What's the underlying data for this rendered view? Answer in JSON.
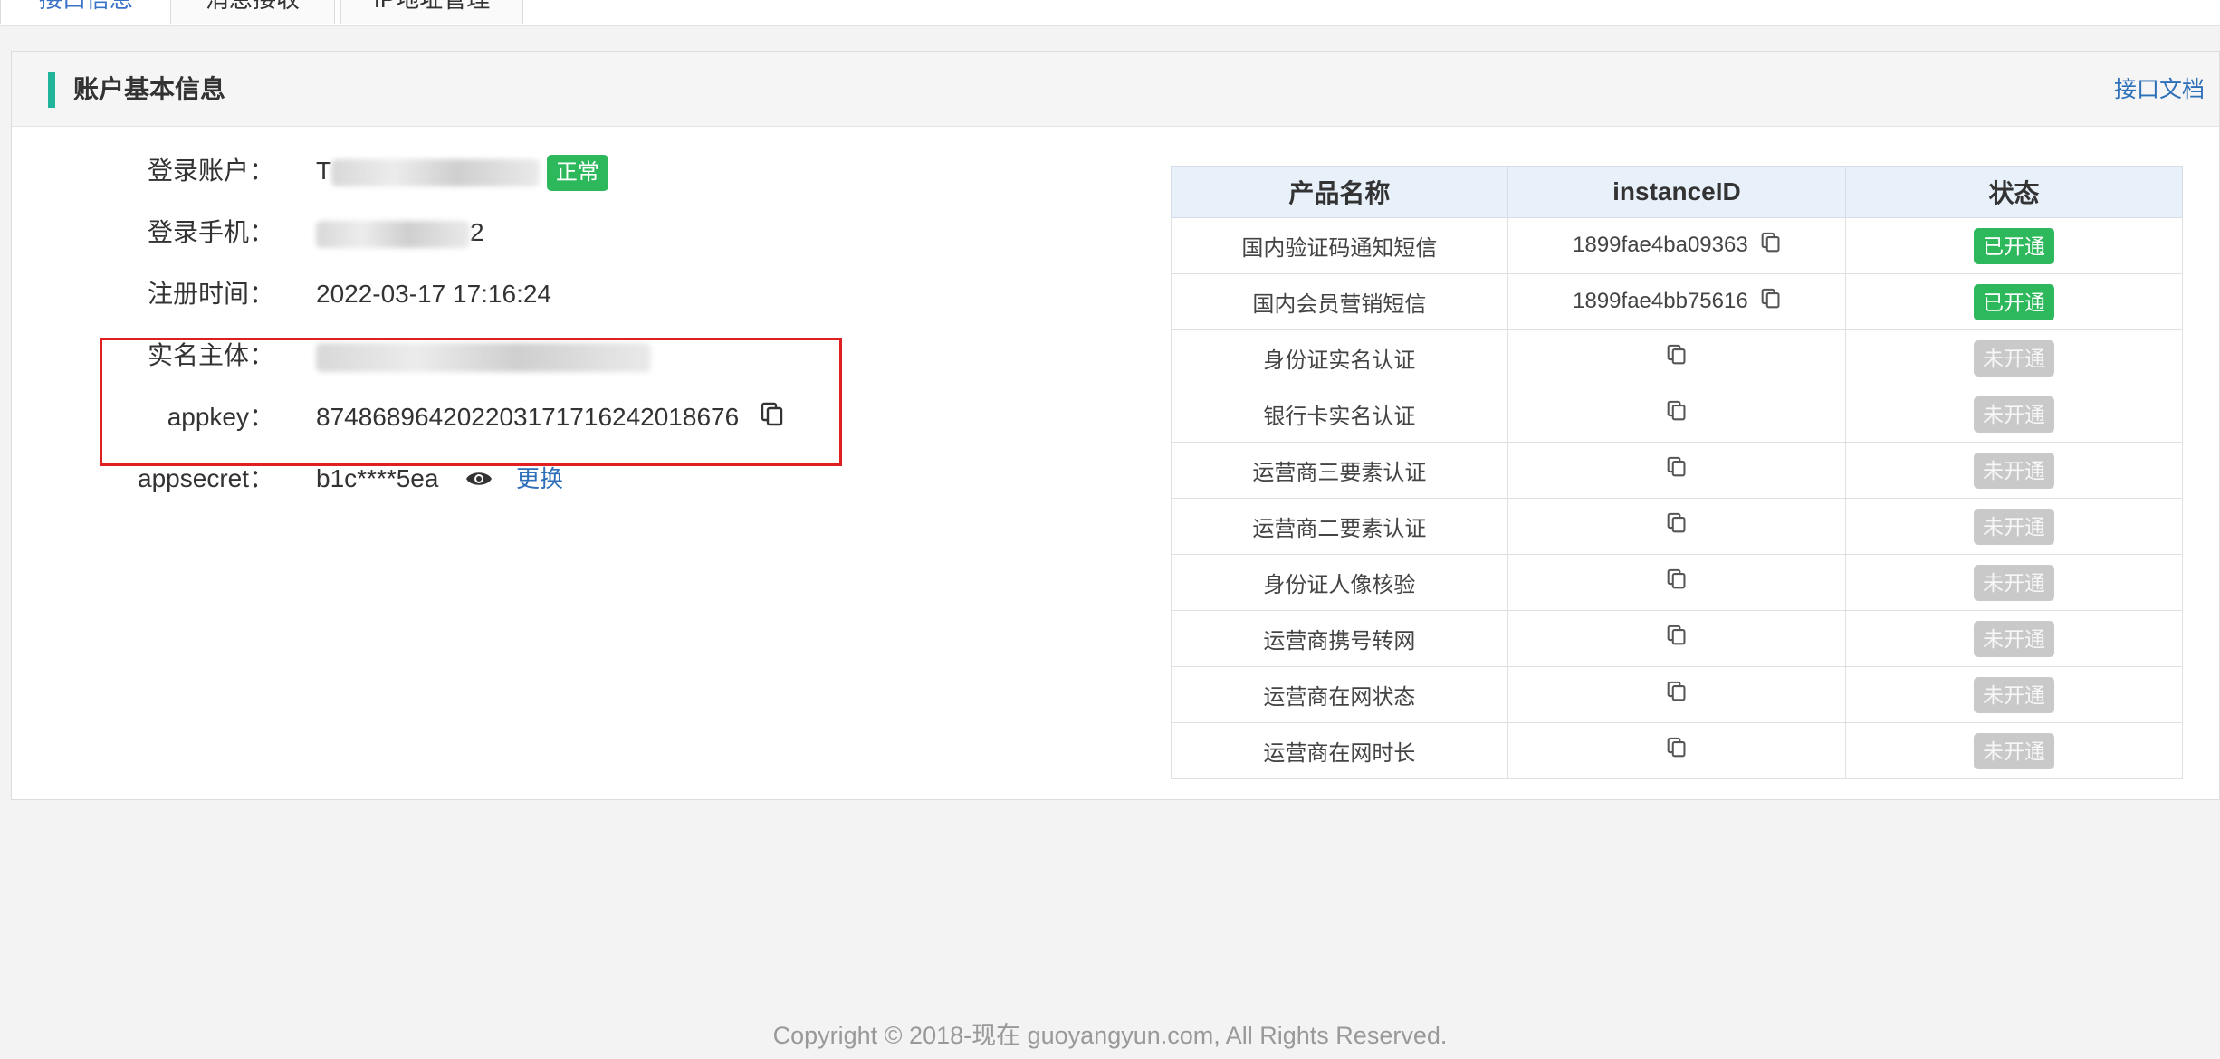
{
  "tabs": [
    {
      "label": "接口信息",
      "active": true
    },
    {
      "label": "消息接收",
      "active": false
    },
    {
      "label": "IP地址管理",
      "active": false
    }
  ],
  "panel": {
    "title": "账户基本信息",
    "doc_link": "接口文档"
  },
  "info": {
    "login_account_label": "登录账户：",
    "login_account_value_prefix": "T",
    "login_account_value_suffix": "",
    "status_badge": "正常",
    "login_phone_label": "登录手机：",
    "login_phone_suffix": "2",
    "register_time_label": "注册时间：",
    "register_time_value": "2022-03-17 17:16:24",
    "real_name_label": "实名主体：",
    "appkey_label": "appkey：",
    "appkey_value": "874868964202203171716242018676",
    "appsecret_label": "appsecret：",
    "appsecret_value": "b1c****5ea",
    "change_label": "更换"
  },
  "table": {
    "headers": [
      "产品名称",
      "instanceID",
      "状态"
    ],
    "rows": [
      {
        "name": "国内验证码通知短信",
        "instance": "1899fae4ba09363",
        "status": "已开通",
        "on": true
      },
      {
        "name": "国内会员营销短信",
        "instance": "1899fae4bb75616",
        "status": "已开通",
        "on": true
      },
      {
        "name": "身份证实名认证",
        "instance": "",
        "status": "未开通",
        "on": false
      },
      {
        "name": "银行卡实名认证",
        "instance": "",
        "status": "未开通",
        "on": false
      },
      {
        "name": "运营商三要素认证",
        "instance": "",
        "status": "未开通",
        "on": false
      },
      {
        "name": "运营商二要素认证",
        "instance": "",
        "status": "未开通",
        "on": false
      },
      {
        "name": "身份证人像核验",
        "instance": "",
        "status": "未开通",
        "on": false
      },
      {
        "name": "运营商携号转网",
        "instance": "",
        "status": "未开通",
        "on": false
      },
      {
        "name": "运营商在网状态",
        "instance": "",
        "status": "未开通",
        "on": false
      },
      {
        "name": "运营商在网时长",
        "instance": "",
        "status": "未开通",
        "on": false
      }
    ]
  },
  "footer": {
    "copyright": "Copyright © 2018-现在 guoyangyun.com, All Rights Reserved."
  }
}
